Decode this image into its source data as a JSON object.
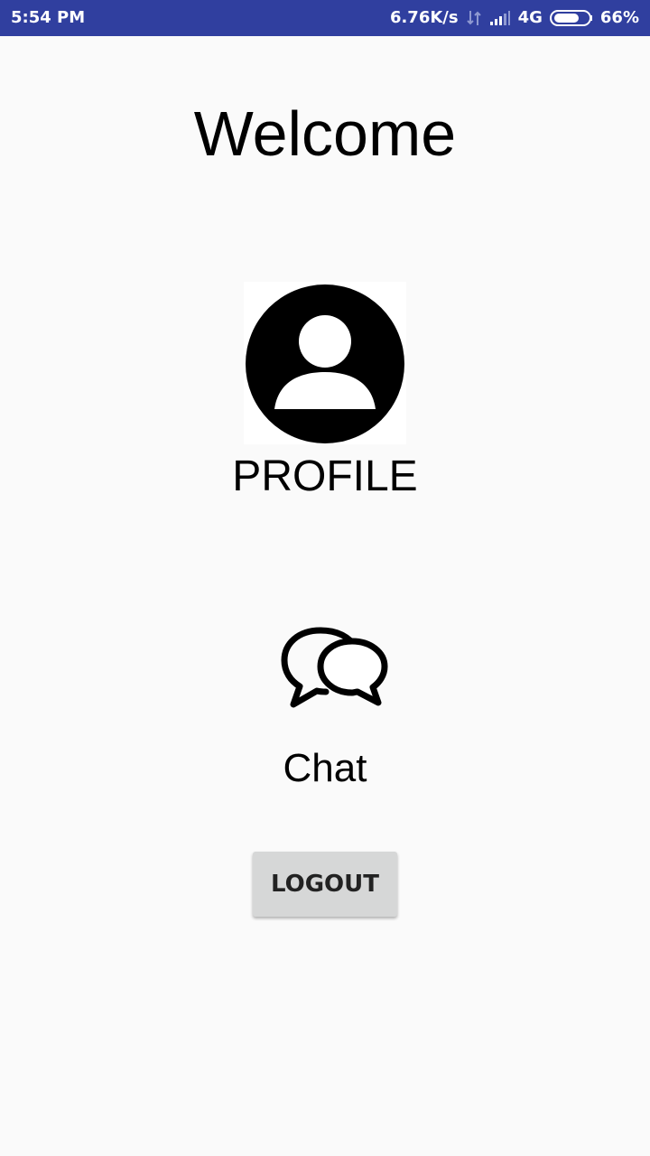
{
  "status_bar": {
    "time": "5:54 PM",
    "net_speed": "6.76K/s",
    "network_type": "4G",
    "battery": "66%",
    "background_color": "#303f9f"
  },
  "main": {
    "welcome_text": "Welcome",
    "profile_label": "PROFILE",
    "profile_icon": "account-circle-icon",
    "chat_label": "Chat",
    "chat_icon": "chat-bubbles-icon",
    "logout_label": "LOGOUT"
  }
}
